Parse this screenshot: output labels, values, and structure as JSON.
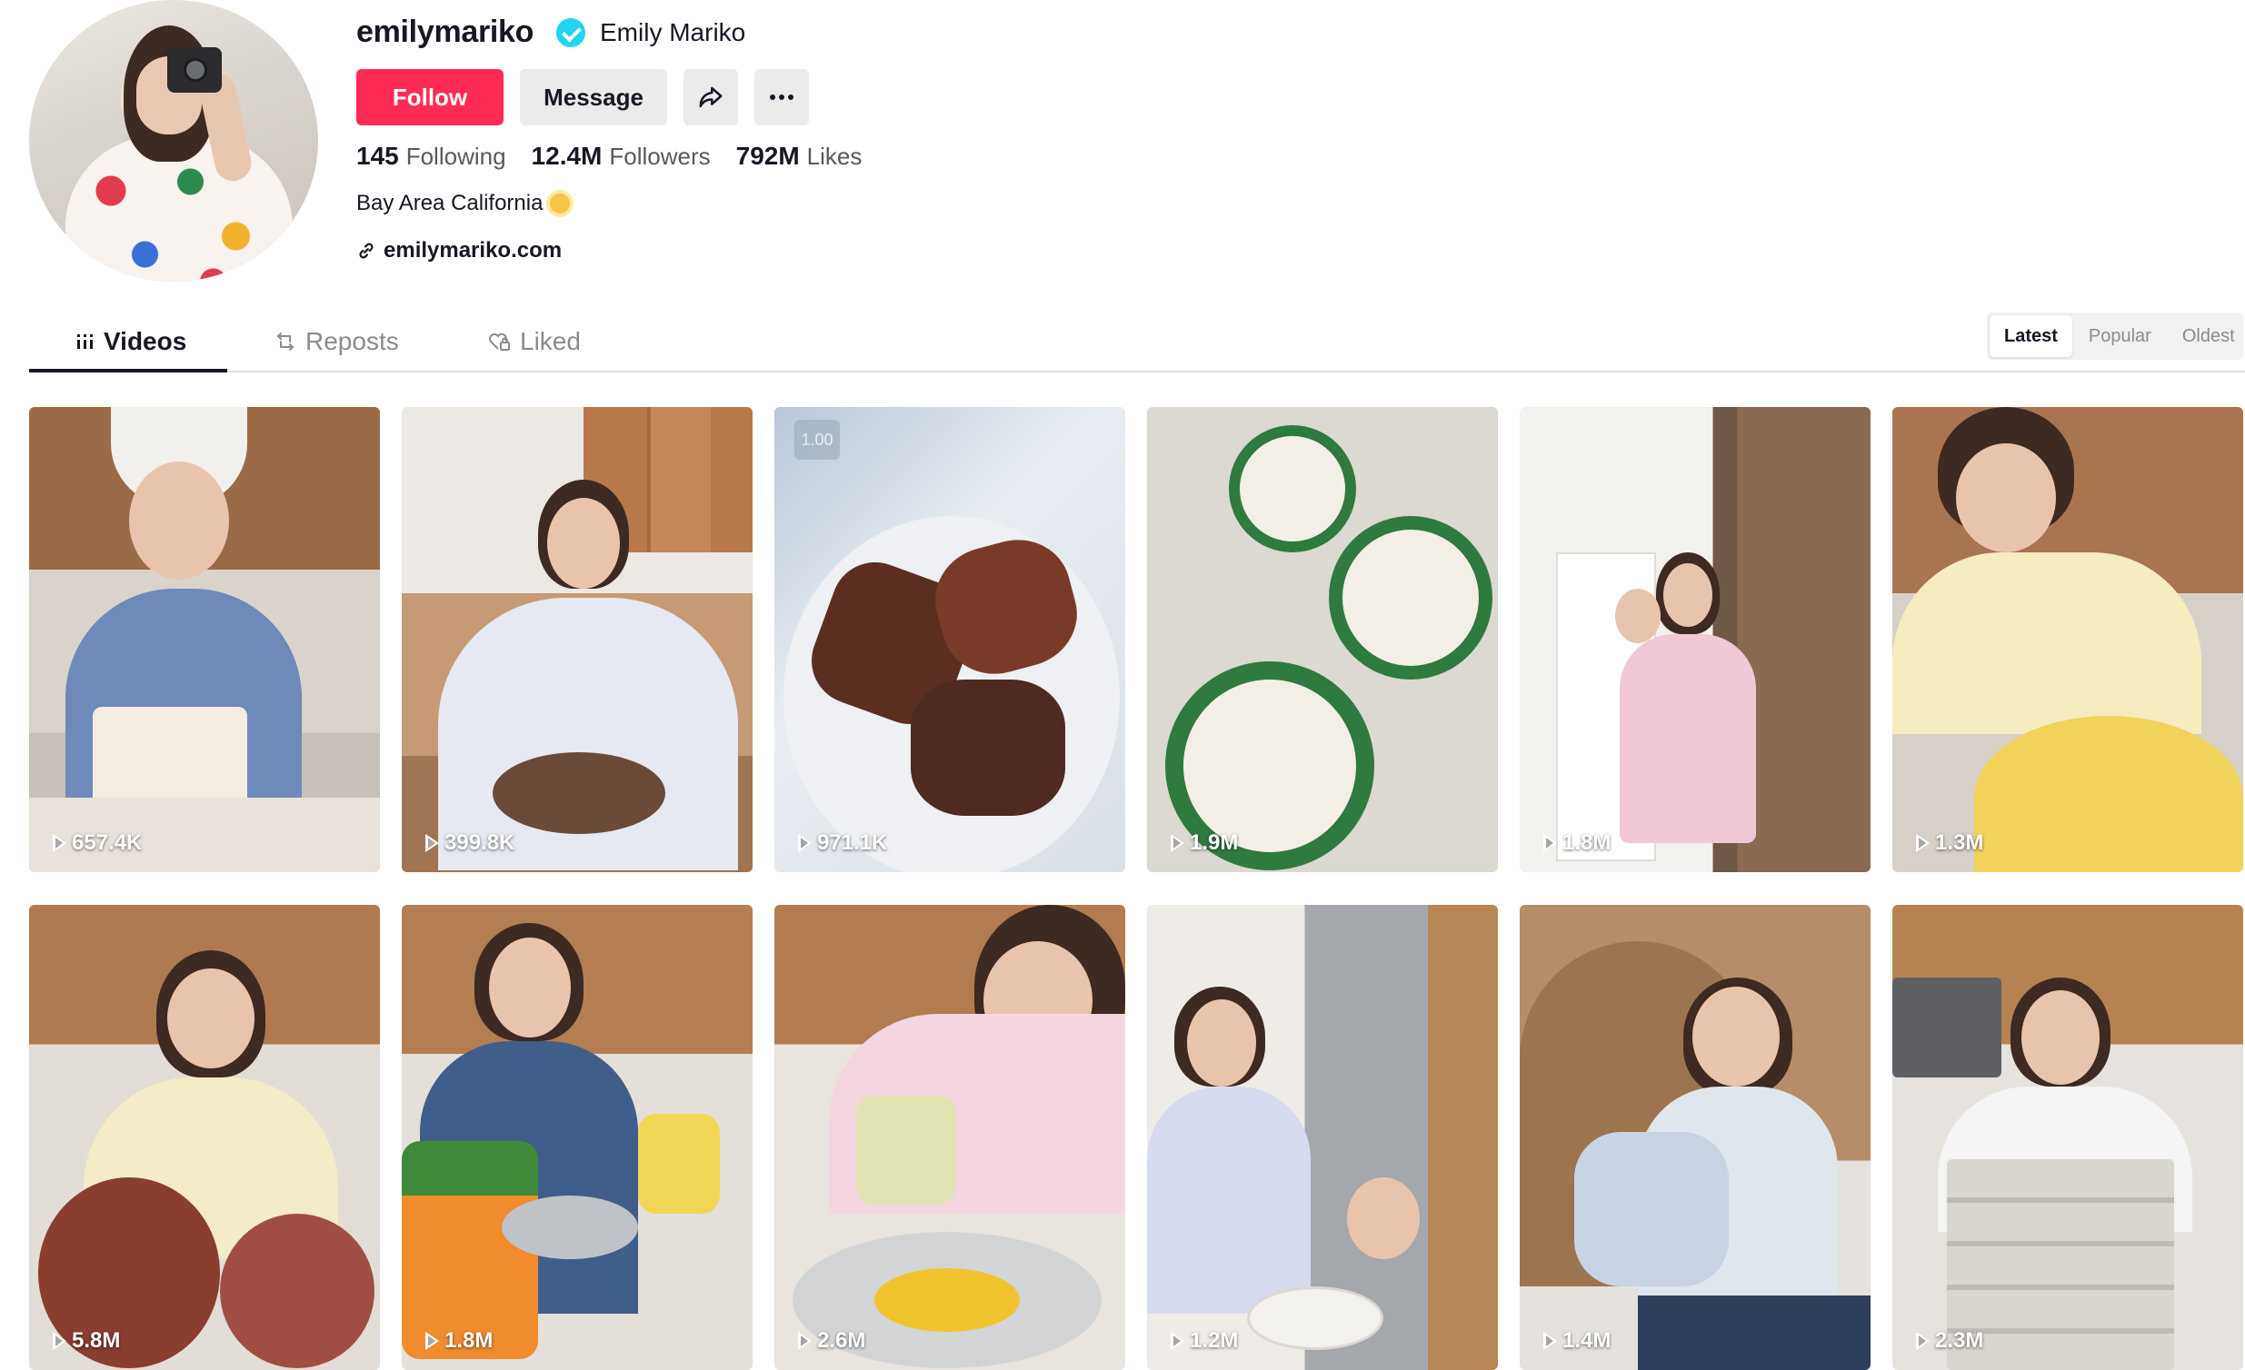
{
  "profile": {
    "username": "emilymariko",
    "nickname": "Emily Mariko",
    "verified": true,
    "follow_label": "Follow",
    "message_label": "Message",
    "following_count": "145",
    "following_label": "Following",
    "followers_count": "12.4M",
    "followers_label": "Followers",
    "likes_count": "792M",
    "likes_label": "Likes",
    "bio": "Bay Area California",
    "bio_icon": "sun-icon",
    "link": "emilymariko.com"
  },
  "tabs": {
    "videos": "Videos",
    "reposts": "Reposts",
    "liked": "Liked"
  },
  "sort": {
    "latest": "Latest",
    "popular": "Popular",
    "oldest": "Oldest"
  },
  "colors": {
    "brand": "#fe2c55",
    "verified": "#20d5ec"
  },
  "videos": [
    {
      "views": "657.4K"
    },
    {
      "views": "399.8K"
    },
    {
      "views": "971.1K",
      "badge": "1.00"
    },
    {
      "views": "1.9M"
    },
    {
      "views": "1.8M"
    },
    {
      "views": "1.3M"
    },
    {
      "views": "5.8M"
    },
    {
      "views": "1.8M"
    },
    {
      "views": "2.6M"
    },
    {
      "views": "1.2M"
    },
    {
      "views": "1.4M"
    },
    {
      "views": "2.3M"
    }
  ]
}
